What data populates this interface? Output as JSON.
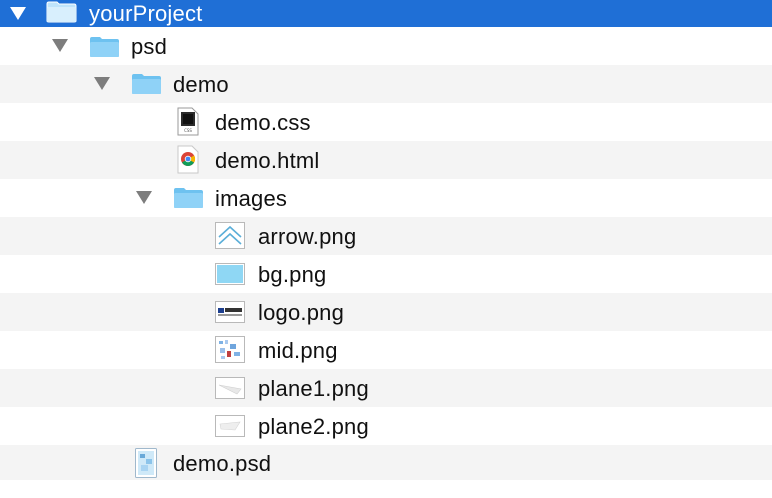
{
  "tree": {
    "root": {
      "label": "yourProject",
      "expanded": true,
      "icon": "folder-icon"
    },
    "psd": {
      "label": "psd",
      "expanded": true,
      "icon": "folder-icon"
    },
    "demo": {
      "label": "demo",
      "expanded": true,
      "icon": "folder-icon"
    },
    "demo_css": {
      "label": "demo.css",
      "icon": "css-file-icon"
    },
    "demo_html": {
      "label": "demo.html",
      "icon": "chrome-html-file-icon"
    },
    "images": {
      "label": "images",
      "expanded": true,
      "icon": "folder-icon"
    },
    "arrow": {
      "label": "arrow.png",
      "icon": "png-thumbnail-icon"
    },
    "bg": {
      "label": "bg.png",
      "icon": "png-thumbnail-icon"
    },
    "logo": {
      "label": "logo.png",
      "icon": "png-thumbnail-icon"
    },
    "mid": {
      "label": "mid.png",
      "icon": "png-thumbnail-icon"
    },
    "plane1": {
      "label": "plane1.png",
      "icon": "png-thumbnail-icon"
    },
    "plane2": {
      "label": "plane2.png",
      "icon": "png-thumbnail-icon"
    },
    "demo_psd": {
      "label": "demo.psd",
      "icon": "psd-file-icon"
    }
  },
  "colors": {
    "selection": "#1f6fd6",
    "folder": "#8fd2f7",
    "stripe": "#f4f4f4"
  }
}
